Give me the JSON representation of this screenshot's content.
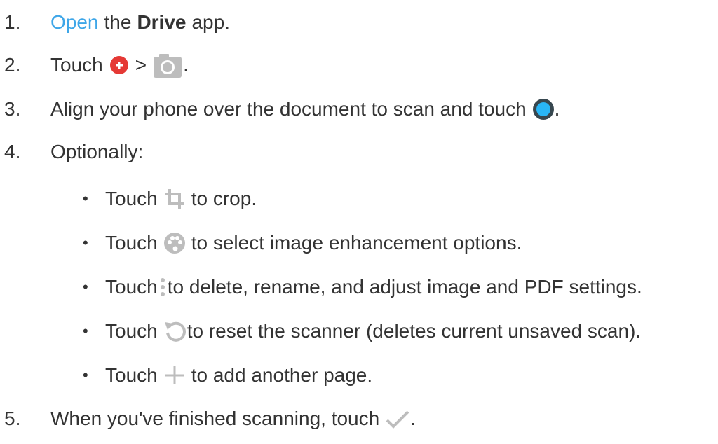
{
  "steps": [
    {
      "num": "1.",
      "link": "Open",
      "pre": "the",
      "bold": "Drive",
      "post": "app."
    },
    {
      "num": "2.",
      "pre": "Touch",
      "sep": ">",
      "post": "."
    },
    {
      "num": "3.",
      "pre": "Align your phone over the document to scan and touch",
      "post": "."
    },
    {
      "num": "4.",
      "text": "Optionally:"
    },
    {
      "num": "5.",
      "pre": "When you've finished scanning, touch",
      "post": "."
    }
  ],
  "sub": [
    {
      "bullet": "•",
      "pre": "Touch",
      "post": "to crop.",
      "icon": "crop-icon"
    },
    {
      "bullet": "•",
      "pre": "Touch",
      "post": "to select image enhancement options.",
      "icon": "palette-icon"
    },
    {
      "bullet": "•",
      "pre": "Touch",
      "post": "to delete, rename, and adjust image and PDF settings.",
      "icon": "more-vert-icon"
    },
    {
      "bullet": "•",
      "pre": "Touch",
      "post": "to reset the scanner (deletes current unsaved scan).",
      "icon": "reset-icon"
    },
    {
      "bullet": "•",
      "pre": "Touch",
      "post": "to add another page.",
      "icon": "plus-icon"
    }
  ],
  "icons": {
    "step2_a": "add-fab-icon",
    "step2_b": "camera-icon",
    "step3": "shutter-icon",
    "step5": "check-icon"
  },
  "colors": {
    "link": "#3ea6e8",
    "text": "#333333",
    "fab_red": "#e53935",
    "icon_gray": "#bdbdbd",
    "shutter_blue": "#29b6f6",
    "shutter_dark": "#37474f"
  }
}
